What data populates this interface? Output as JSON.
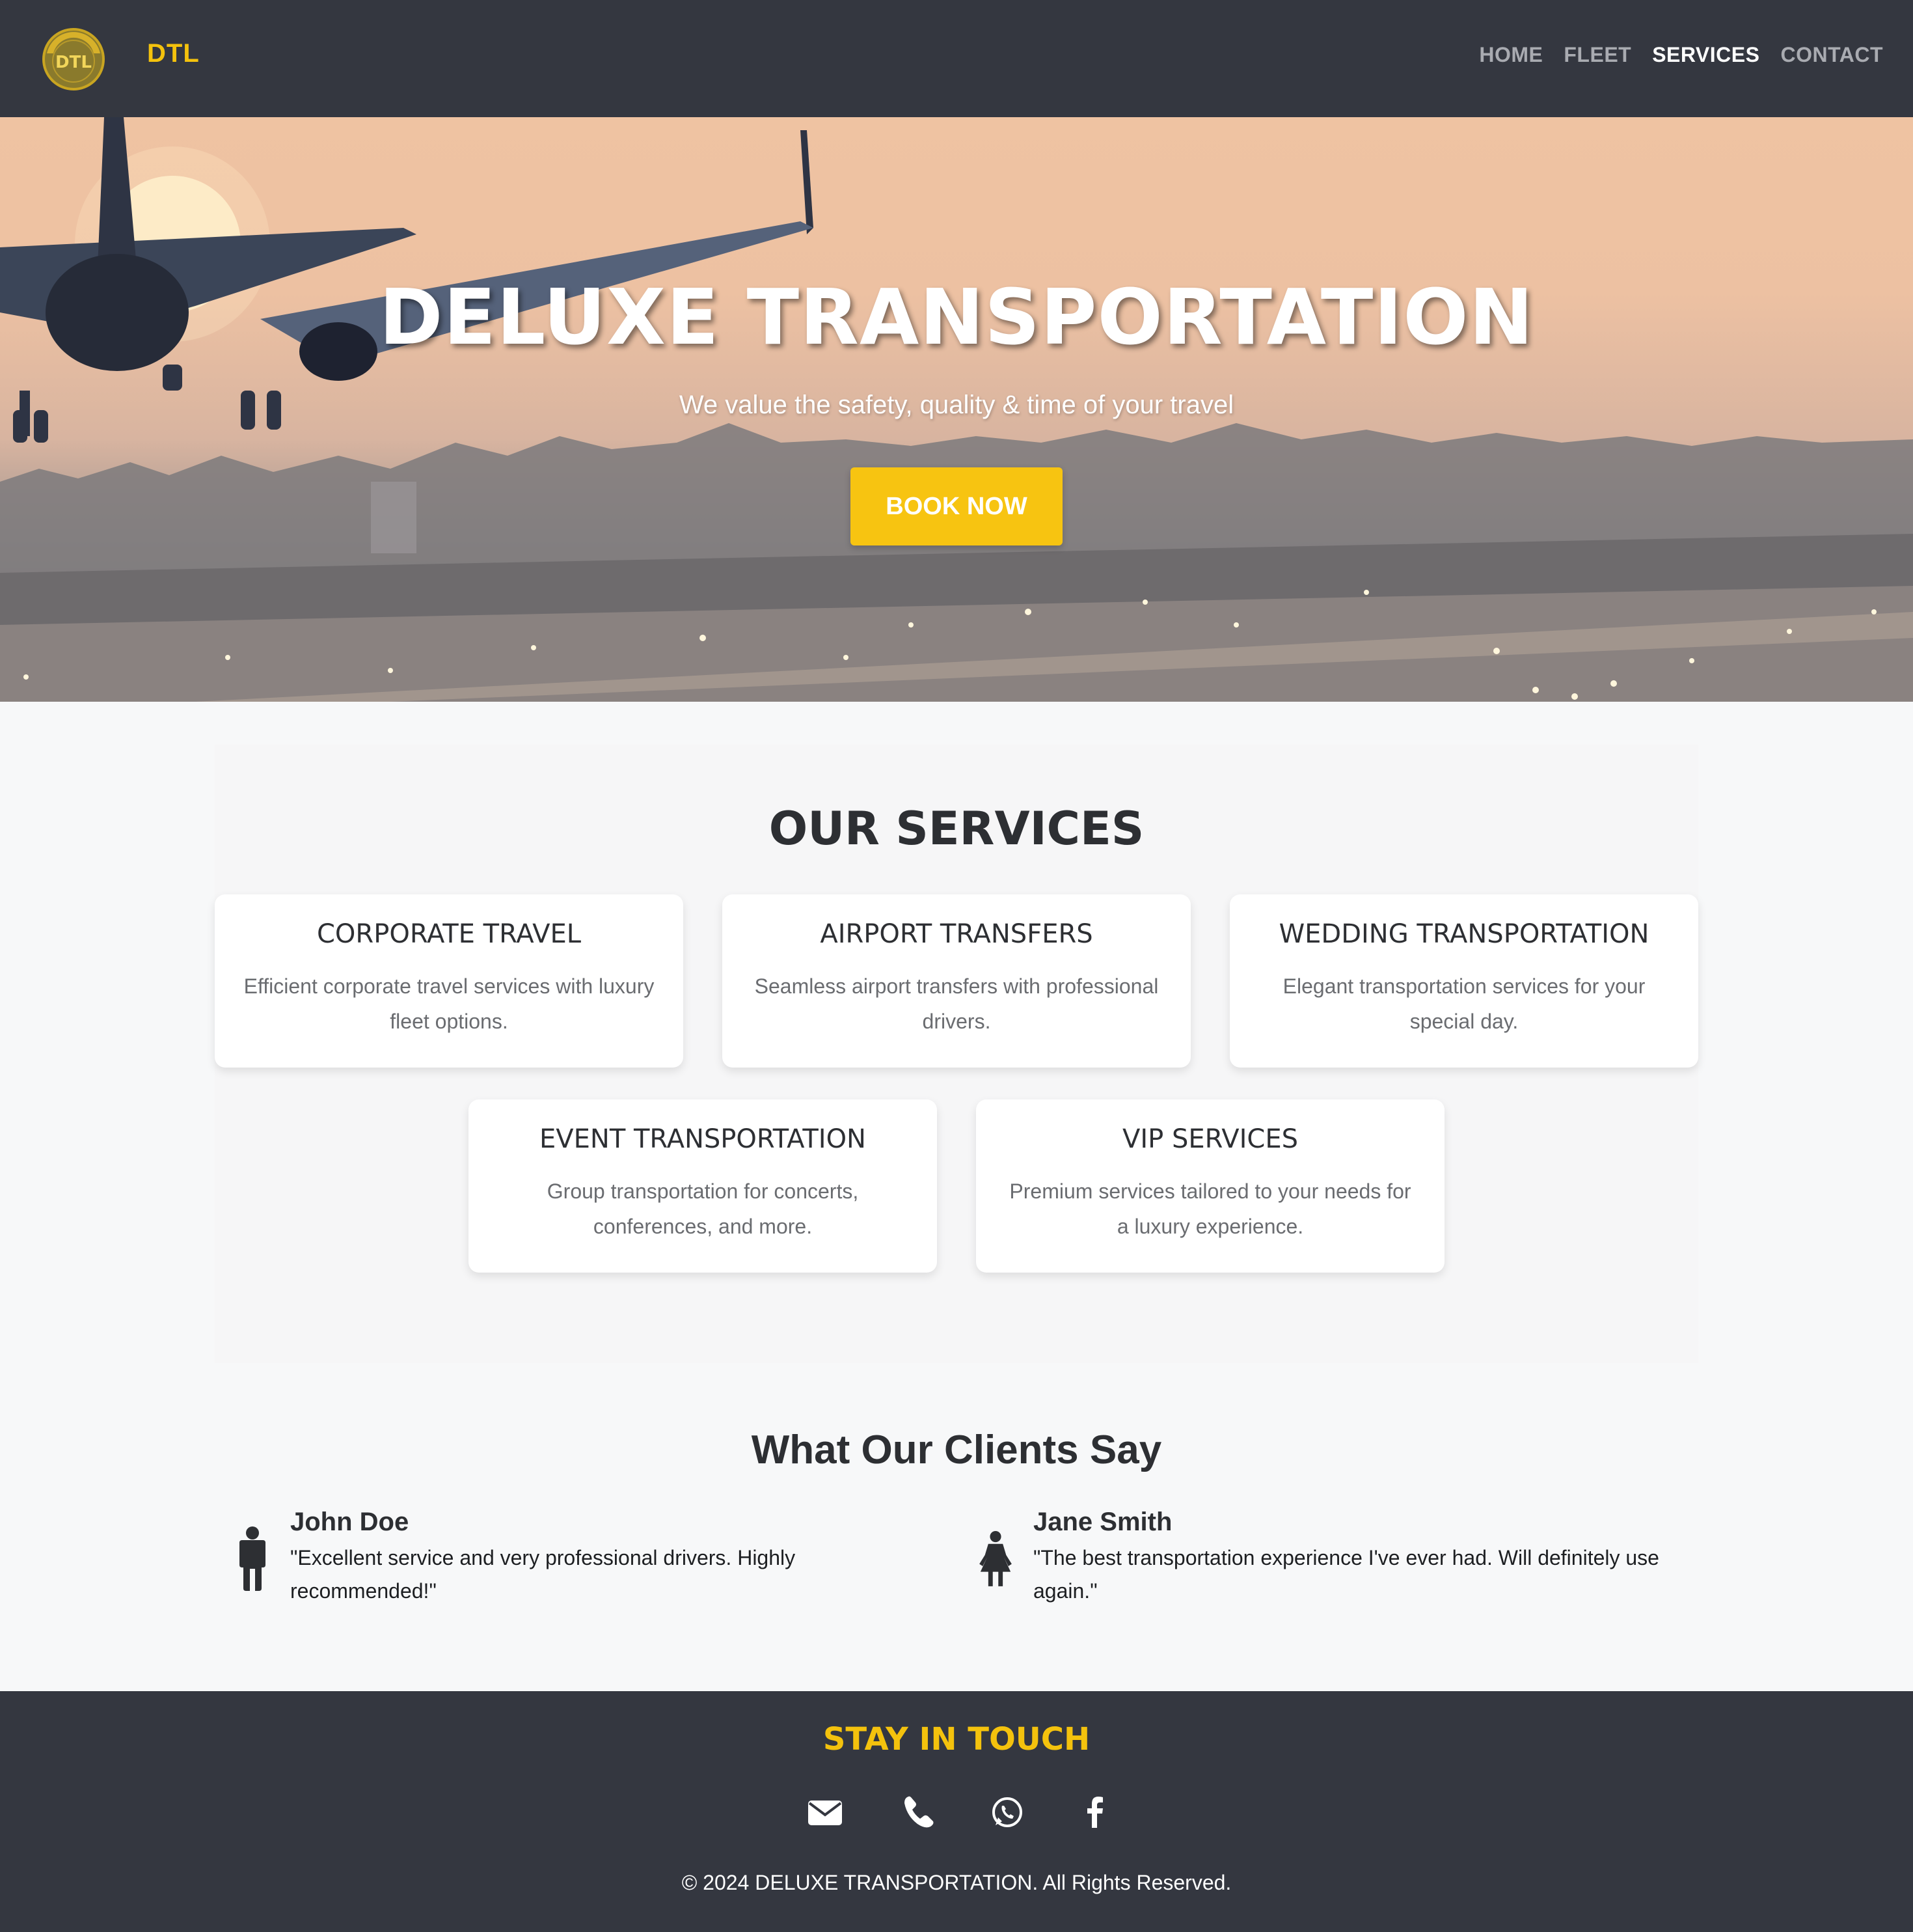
{
  "header": {
    "brand": "DTL",
    "logo_text": "DTL",
    "nav": [
      {
        "label": "HOME",
        "active": false
      },
      {
        "label": "FLEET",
        "active": false
      },
      {
        "label": "SERVICES",
        "active": true
      },
      {
        "label": "CONTACT",
        "active": false
      }
    ]
  },
  "hero": {
    "title": "DELUXE TRANSPORTATION",
    "subtitle": "We value the safety, quality & time of your travel",
    "cta_label": "BOOK NOW"
  },
  "services": {
    "title": "OUR SERVICES",
    "items": [
      {
        "title": "CORPORATE TRAVEL",
        "description": "Efficient corporate travel services with luxury fleet options."
      },
      {
        "title": "AIRPORT TRANSFERS",
        "description": "Seamless airport transfers with professional drivers."
      },
      {
        "title": "WEDDING TRANSPORTATION",
        "description": "Elegant transportation services for your special day."
      },
      {
        "title": "EVENT TRANSPORTATION",
        "description": "Group transportation for concerts, conferences, and more."
      },
      {
        "title": "VIP SERVICES",
        "description": "Premium services tailored to your needs for a luxury experience."
      }
    ]
  },
  "testimonials": {
    "title": "What Our Clients Say",
    "items": [
      {
        "name": "John Doe",
        "quote": "\"Excellent service and very professional drivers. Highly recommended!\"",
        "icon": "male-person-icon"
      },
      {
        "name": "Jane Smith",
        "quote": "\"The best transportation experience I've ever had. Will definitely use again.\"",
        "icon": "female-person-icon"
      }
    ]
  },
  "footer": {
    "title": "STAY IN TOUCH",
    "social": [
      "envelope-icon",
      "phone-icon",
      "whatsapp-icon",
      "facebook-icon"
    ],
    "copyright": "© 2024 DELUXE TRANSPORTATION. All Rights Reserved."
  },
  "colors": {
    "header_bg": "#343740",
    "accent": "#f4c20d",
    "button": "#f7c411",
    "page_bg": "#f7f8f9"
  }
}
